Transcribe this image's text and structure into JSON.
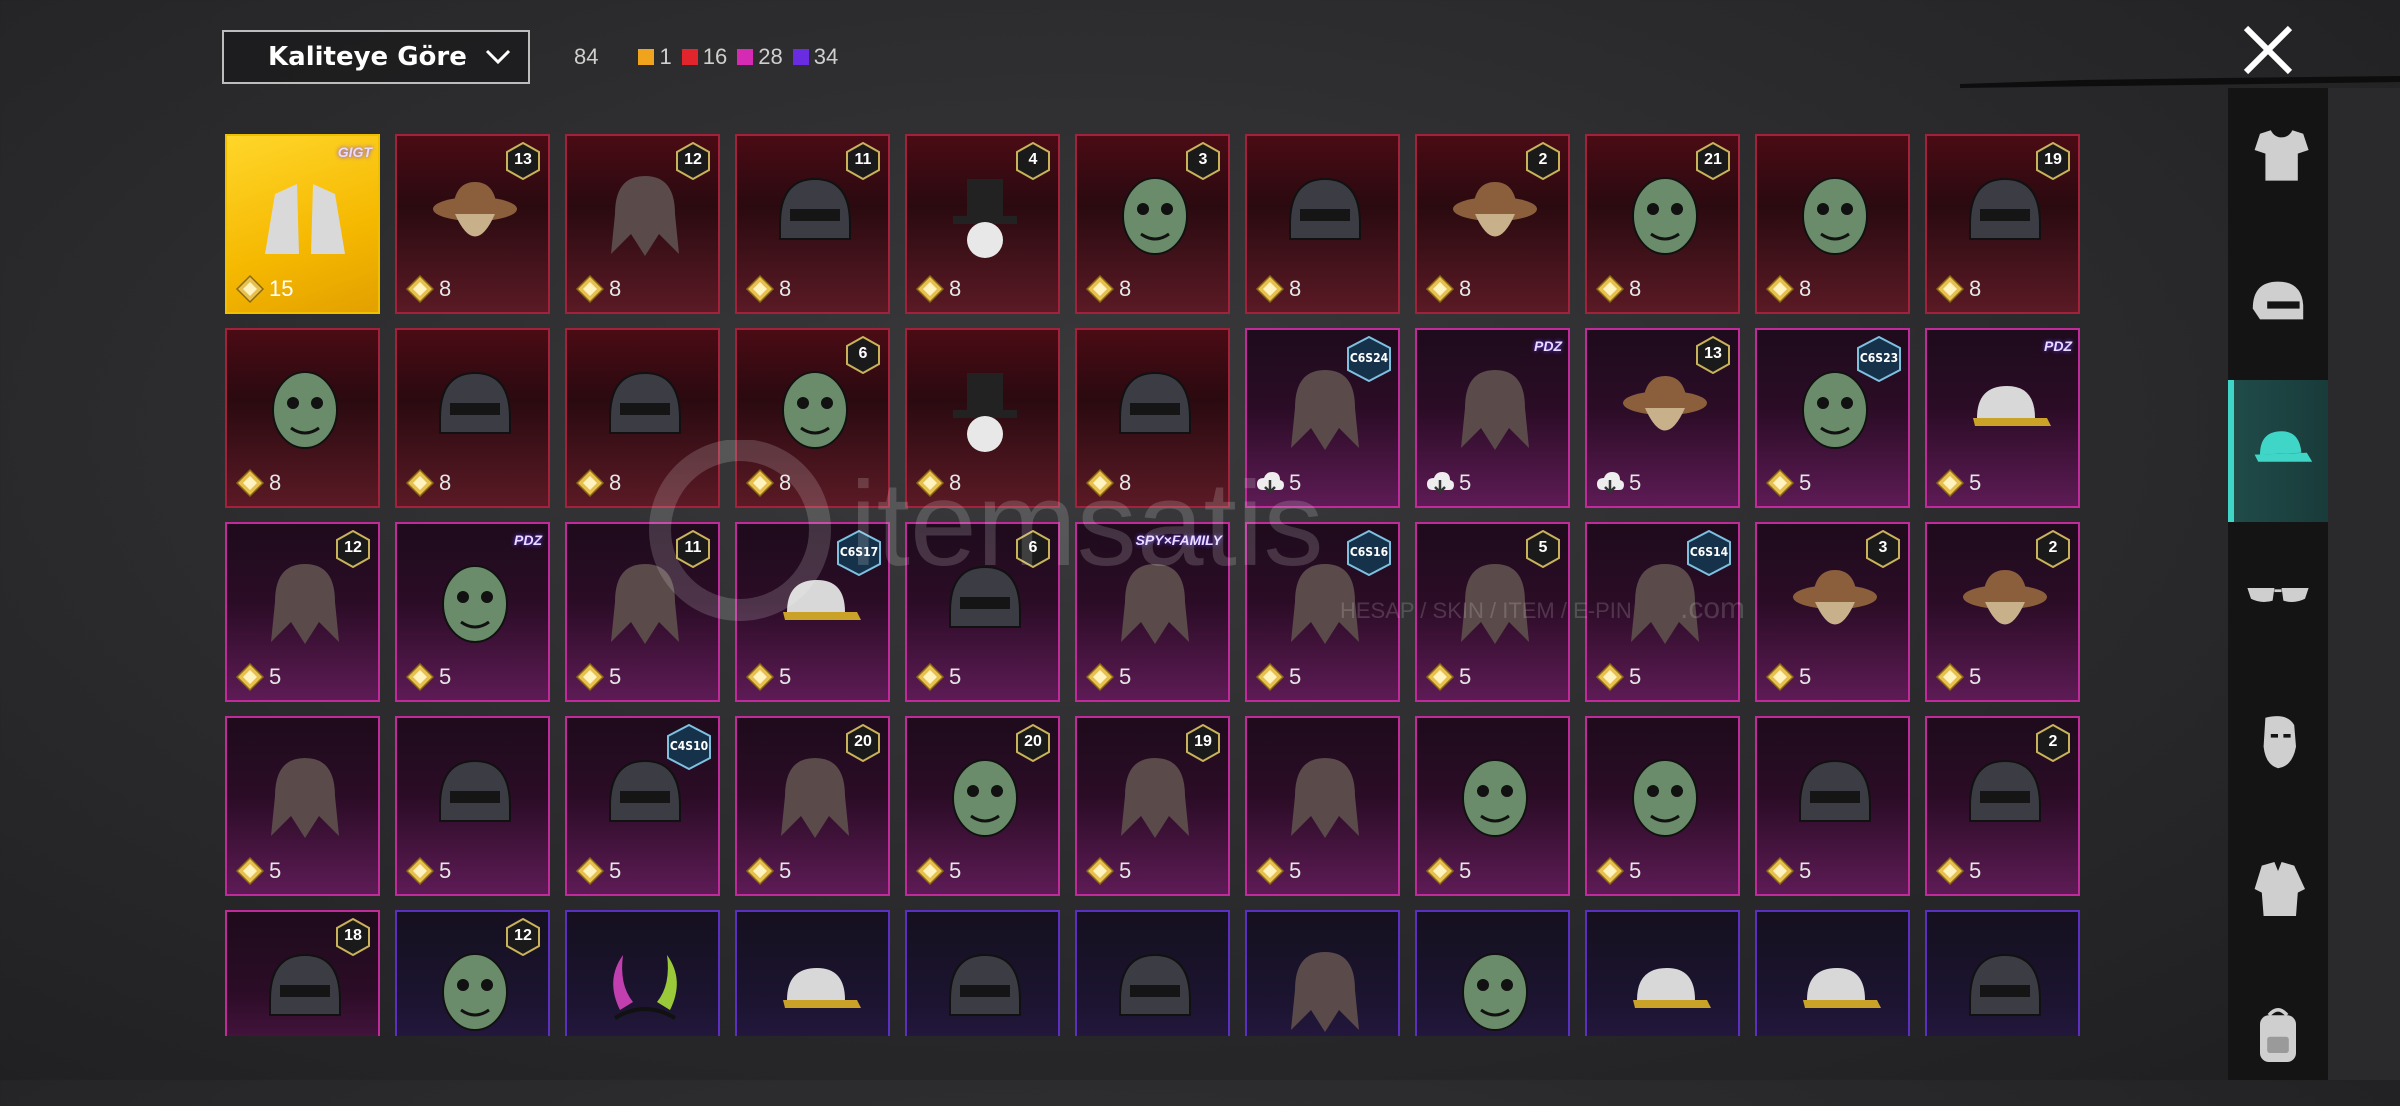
{
  "header": {
    "sort_label": "Kaliteye Göre",
    "total_count": "84",
    "quality_counts": [
      {
        "color": "#f0a31c",
        "count": "1"
      },
      {
        "color": "#e2242d",
        "count": "16"
      },
      {
        "color": "#d52ab3",
        "count": "28"
      },
      {
        "color": "#6a2ce0",
        "count": "34"
      }
    ]
  },
  "colors": {
    "gold": "#f0c000",
    "red": "#a3213a",
    "magenta": "#c02a9a",
    "purple": "#5a2fc2",
    "active_category": "#3fd6c8"
  },
  "watermark": {
    "brand": "itemsatis",
    "tagline": "HESAP / SKIN / ITEM / E-PIN",
    "suffix": ".com"
  },
  "items": [
    {
      "quality": "gold",
      "points": "15",
      "brand": "GIGT",
      "art": "fur-gloves"
    },
    {
      "quality": "red",
      "points": "8",
      "level": "13",
      "art": "hat"
    },
    {
      "quality": "red",
      "points": "8",
      "level": "12",
      "art": "hair"
    },
    {
      "quality": "red",
      "points": "8",
      "level": "11",
      "art": "helmet"
    },
    {
      "quality": "red",
      "points": "8",
      "level": "4",
      "art": "top-hat"
    },
    {
      "quality": "red",
      "points": "8",
      "level": "3",
      "art": "mask"
    },
    {
      "quality": "red",
      "points": "8",
      "art": "helmet"
    },
    {
      "quality": "red",
      "points": "8",
      "level": "2",
      "art": "hat"
    },
    {
      "quality": "red",
      "points": "8",
      "level": "21",
      "art": "mask"
    },
    {
      "quality": "red",
      "points": "8",
      "art": "mask"
    },
    {
      "quality": "red",
      "points": "8",
      "level": "19",
      "art": "helmet"
    },
    {
      "quality": "red",
      "points": "8",
      "art": "mask"
    },
    {
      "quality": "red",
      "points": "8",
      "art": "helmet"
    },
    {
      "quality": "red",
      "points": "8",
      "art": "helmet"
    },
    {
      "quality": "red",
      "points": "8",
      "level": "6",
      "art": "mask"
    },
    {
      "quality": "red",
      "points": "8",
      "art": "top-hat"
    },
    {
      "quality": "red",
      "points": "8",
      "art": "helmet"
    },
    {
      "quality": "magenta",
      "points": "5",
      "season": "C6S24",
      "cloud": true,
      "art": "hair"
    },
    {
      "quality": "magenta",
      "points": "5",
      "brand": "PDZ",
      "cloud": true,
      "art": "hair"
    },
    {
      "quality": "magenta",
      "points": "5",
      "level": "13",
      "cloud": true,
      "art": "hat"
    },
    {
      "quality": "magenta",
      "points": "5",
      "season": "C6S23",
      "art": "mask"
    },
    {
      "quality": "magenta",
      "points": "5",
      "brand": "PDZ",
      "art": "cap"
    },
    {
      "quality": "magenta",
      "points": "5",
      "level": "12",
      "art": "hair"
    },
    {
      "quality": "magenta",
      "points": "5",
      "brand": "PDZ",
      "art": "mask"
    },
    {
      "quality": "magenta",
      "points": "5",
      "level": "11",
      "art": "hair"
    },
    {
      "quality": "magenta",
      "points": "5",
      "season": "C6S17",
      "art": "cap"
    },
    {
      "quality": "magenta",
      "points": "5",
      "level": "6",
      "art": "helmet"
    },
    {
      "quality": "magenta",
      "points": "5",
      "brand": "SPY×FAMILY",
      "art": "hair"
    },
    {
      "quality": "magenta",
      "points": "5",
      "season": "C6S16",
      "art": "hair"
    },
    {
      "quality": "magenta",
      "points": "5",
      "level": "5",
      "art": "hair"
    },
    {
      "quality": "magenta",
      "points": "5",
      "season": "C6S14",
      "art": "hair"
    },
    {
      "quality": "magenta",
      "points": "5",
      "level": "3",
      "art": "hat"
    },
    {
      "quality": "magenta",
      "points": "5",
      "level": "2",
      "art": "hat"
    },
    {
      "quality": "magenta",
      "points": "5",
      "art": "hair"
    },
    {
      "quality": "magenta",
      "points": "5",
      "art": "helmet"
    },
    {
      "quality": "magenta",
      "points": "5",
      "season": "C4S10",
      "art": "helmet"
    },
    {
      "quality": "magenta",
      "points": "5",
      "level": "20",
      "art": "hair"
    },
    {
      "quality": "magenta",
      "points": "5",
      "level": "20",
      "art": "mask"
    },
    {
      "quality": "magenta",
      "points": "5",
      "level": "19",
      "art": "hair"
    },
    {
      "quality": "magenta",
      "points": "5",
      "art": "hair"
    },
    {
      "quality": "magenta",
      "points": "5",
      "art": "mask"
    },
    {
      "quality": "magenta",
      "points": "5",
      "art": "mask"
    },
    {
      "quality": "magenta",
      "points": "5",
      "art": "helmet"
    },
    {
      "quality": "magenta",
      "points": "5",
      "level": "2",
      "art": "helmet"
    },
    {
      "quality": "magenta",
      "level": "18",
      "art": "helmet"
    },
    {
      "quality": "purple",
      "level": "12",
      "art": "mask"
    },
    {
      "quality": "purple",
      "art": "horns"
    },
    {
      "quality": "purple",
      "art": "cap"
    },
    {
      "quality": "purple",
      "art": "helmet"
    },
    {
      "quality": "purple",
      "art": "helmet"
    },
    {
      "quality": "purple",
      "art": "hair"
    },
    {
      "quality": "purple",
      "art": "mask"
    },
    {
      "quality": "purple",
      "art": "cap"
    },
    {
      "quality": "purple",
      "art": "cap"
    },
    {
      "quality": "purple",
      "art": "helmet"
    }
  ],
  "categories": [
    {
      "name": "outfit-icon",
      "active": false
    },
    {
      "name": "helmet-icon",
      "active": false
    },
    {
      "name": "cap-icon",
      "active": true
    },
    {
      "name": "glasses-icon",
      "active": false
    },
    {
      "name": "face-icon",
      "active": false
    },
    {
      "name": "jacket-icon",
      "active": false
    },
    {
      "name": "backpack-icon",
      "active": false
    }
  ]
}
